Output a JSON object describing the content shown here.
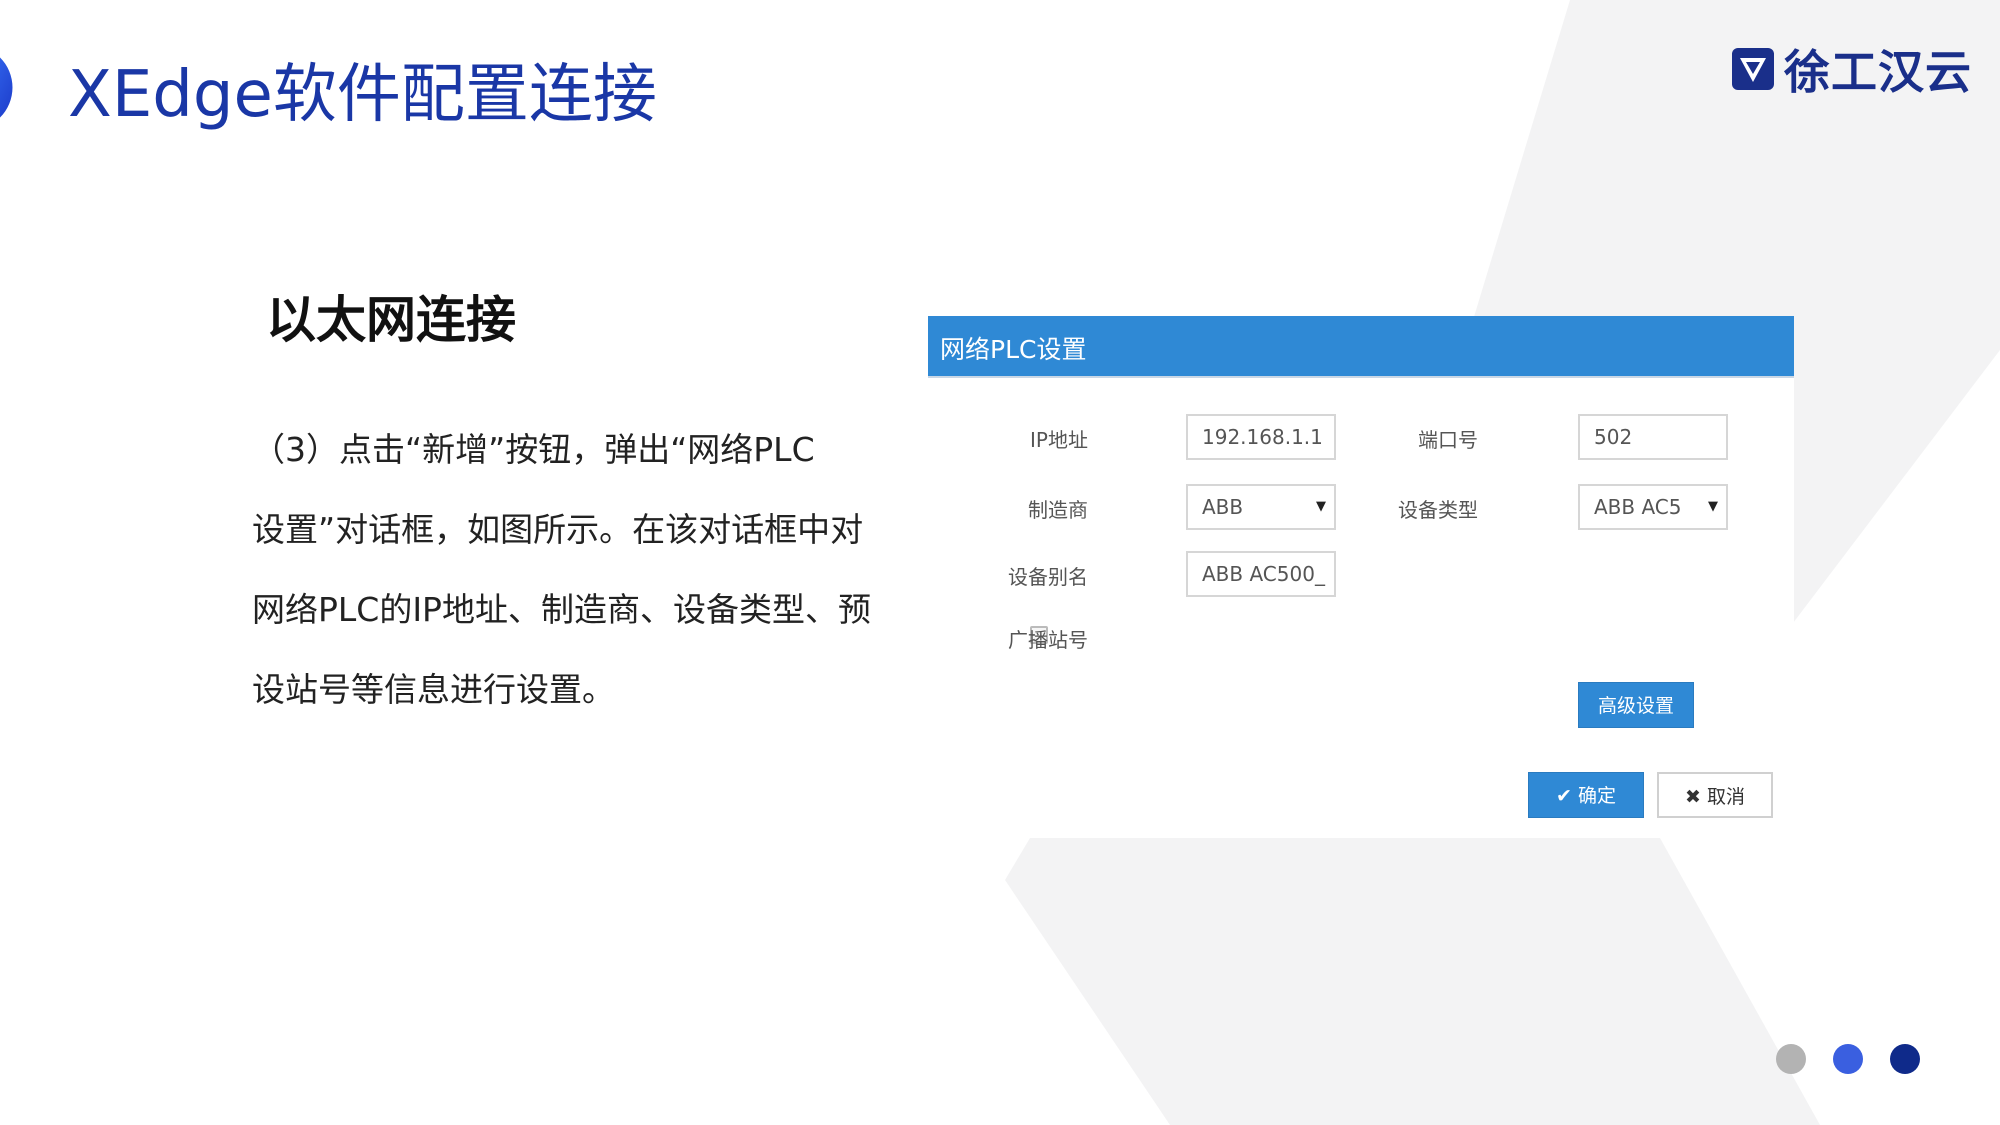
{
  "slide": {
    "title": "XEdge软件配置连接",
    "logo_text": "徐工汉云",
    "section_heading": "以太网连接",
    "body_lines": [
      "（3）点击“新增”按钮，弹出“网络PLC",
      "设置”对话框，如图所示。在该对话框中对",
      "网络PLC的IP地址、制造商、设备类型、预",
      "设站号等信息进行设置。"
    ]
  },
  "dialog": {
    "title": "网络PLC设置",
    "ip_label": "IP地址",
    "ip_value": "192.168.1.1",
    "port_label": "端口号",
    "port_value": "502",
    "manufacturer_label": "制造商",
    "manufacturer_value": "ABB",
    "device_type_label": "设备类型",
    "device_type_value": "ABB AC5",
    "alias_label": "设备别名",
    "alias_value": "ABB AC500_",
    "broadcast_label": "广播站号",
    "advanced_button": "高级设置",
    "ok_button": "确定",
    "cancel_button": "取消"
  },
  "colors": {
    "title_blue": "#1a37a6",
    "header_blue": "#2f89d5",
    "dot_gray": "#b3b3b3",
    "dot_blue": "#3a5fe0",
    "dot_navy": "#0f2a8a"
  },
  "icons": {
    "ok": "check-icon",
    "cancel": "x-icon",
    "dropdown": "caret-down-icon",
    "logo": "logo-shield-icon"
  }
}
